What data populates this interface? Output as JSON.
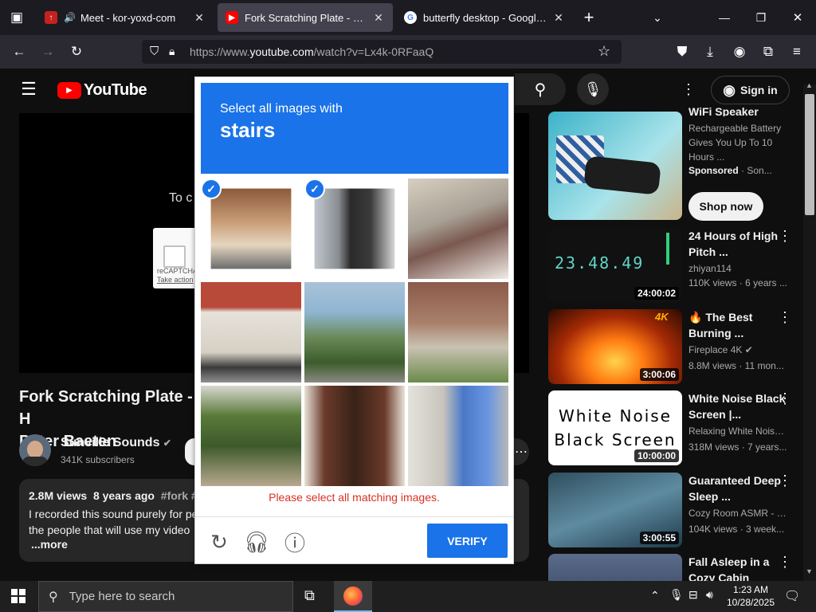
{
  "browser": {
    "tabs": [
      {
        "title": "Meet - kor-yoxd-com",
        "favicon": "meet-icon",
        "audio": true
      },
      {
        "title": "Fork Scratching Plate - House-H",
        "favicon": "youtube-icon",
        "active": true
      },
      {
        "title": "butterfly desktop - Google Sear",
        "favicon": "google-icon"
      }
    ],
    "url_prefix": "https://www.",
    "url_domain": "youtube.com",
    "url_path": "/watch?v=Lx4k-0RFaaQ"
  },
  "youtube": {
    "logo_text": "YouTube",
    "sign_in": "Sign in",
    "player_partial_text": "To c",
    "recaptcha_label": "reCAPTCHA",
    "recaptcha_link": "Take action",
    "video_title_line1": "Fork Scratching Plate - H",
    "video_title_line2": "Peter Baeten",
    "channel_name": "Sunville Sounds",
    "subscribers": "341K subscribers",
    "views": "2.8M views",
    "age": "8 years ago",
    "tags": "#fork #s",
    "desc_line1": "I recorded this sound purely for pe",
    "desc_line2": "the people that will use my video",
    "desc_trail": "r",
    "more": "...more",
    "ad": {
      "title_partial": "WiFi Speaker",
      "desc": "Rechargeable Battery Gives You Up To 10 Hours ...",
      "sponsored": "Sponsored",
      "sponsor_name": "· Son...",
      "cta": "Shop now"
    },
    "sidebar": [
      {
        "title": "24 Hours of High Pitch ...",
        "channel": "zhiyan114",
        "meta": "110K views · 6 years ...",
        "duration": "24:00:02",
        "thumb_text": "23.48.49"
      },
      {
        "title": "🔥 The Best Burning ...",
        "channel": "Fireplace 4K",
        "meta": "8.8M views · 11 mon...",
        "duration": "3:00:06",
        "badge": "4K",
        "verified": true
      },
      {
        "title": "White Noise Black Screen |...",
        "channel": "Relaxing White Noise...",
        "meta": "318M views · 7 years...",
        "duration": "10:00:00",
        "thumb_text1": "White Noise",
        "thumb_text2": "Black Screen"
      },
      {
        "title": "Guaranteed Deep Sleep ...",
        "channel": "Cozy Room ASMR - S...",
        "meta": "104K views · 3 week...",
        "duration": "3:00:55"
      },
      {
        "title": "Fall Asleep in a Cozy Cabin",
        "channel": "",
        "meta": "",
        "duration": ""
      }
    ]
  },
  "captcha": {
    "prompt": "Select all images with",
    "target": "stairs",
    "error": "Please select all matching images.",
    "verify_label": "VERIFY",
    "tiles": [
      {
        "subject": "arched doorway with stairs",
        "selected": true
      },
      {
        "subject": "stairs by doorway",
        "selected": true
      },
      {
        "subject": "apartment balconies",
        "selected": false
      },
      {
        "subject": "house with red roof and balcony",
        "selected": false
      },
      {
        "subject": "street with hedges",
        "selected": false
      },
      {
        "subject": "outdoor brick stairs",
        "selected": false
      },
      {
        "subject": "building with trees",
        "selected": false
      },
      {
        "subject": "balcony with doorway",
        "selected": false
      },
      {
        "subject": "tall apartment building",
        "selected": false
      }
    ]
  },
  "taskbar": {
    "search_placeholder": "Type here to search",
    "time": "1:23 AM",
    "date": "10/28/2025"
  }
}
